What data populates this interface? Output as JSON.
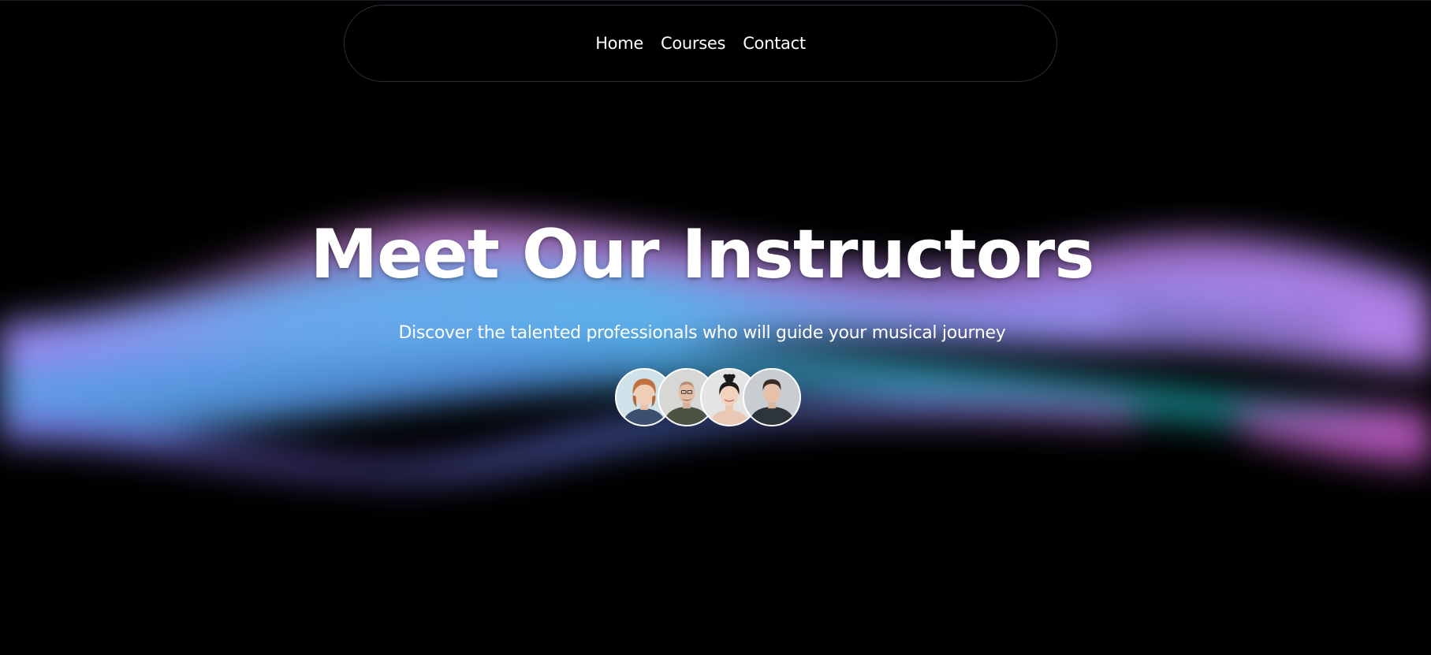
{
  "nav": {
    "links": [
      {
        "label": "Home"
      },
      {
        "label": "Courses"
      },
      {
        "label": "Contact"
      }
    ]
  },
  "hero": {
    "title": "Meet Our Instructors",
    "subtitle": "Discover the talented professionals who will guide your musical journey"
  },
  "avatars": [
    {
      "name": "instructor-avatar-1",
      "icon": "person-photo"
    },
    {
      "name": "instructor-avatar-2",
      "icon": "person-photo"
    },
    {
      "name": "instructor-avatar-3",
      "icon": "person-photo"
    },
    {
      "name": "instructor-avatar-4",
      "icon": "person-photo"
    }
  ],
  "colors": {
    "background": "#000000",
    "wave_purple": "#9b7bea",
    "wave_blue": "#5aa8e8",
    "wave_teal": "#1aa3a8",
    "wave_pink": "#c45bc8"
  }
}
